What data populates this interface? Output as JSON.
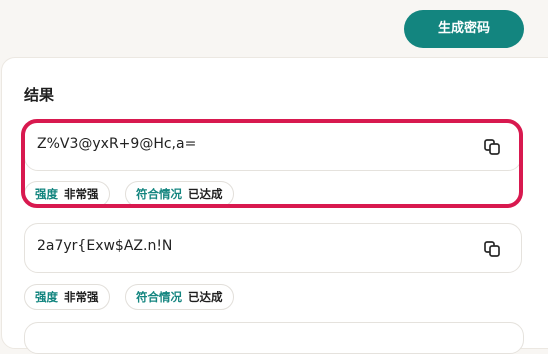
{
  "header": {
    "generate_label": "生成密码"
  },
  "results": {
    "title": "结果",
    "items": [
      {
        "password": "Z%V3@yxR+9@Hc,a=",
        "strength_label": "强度",
        "strength_value": "非常强",
        "compliance_label": "符合情况",
        "compliance_value": "已达成"
      },
      {
        "password": "2a7yr{Exw$AZ.n!N",
        "strength_label": "强度",
        "strength_value": "非常强",
        "compliance_label": "符合情况",
        "compliance_value": "已达成"
      }
    ]
  },
  "colors": {
    "accent": "#13857f",
    "highlight": "#d8194f"
  },
  "icons": {
    "copy": "copy-icon"
  }
}
